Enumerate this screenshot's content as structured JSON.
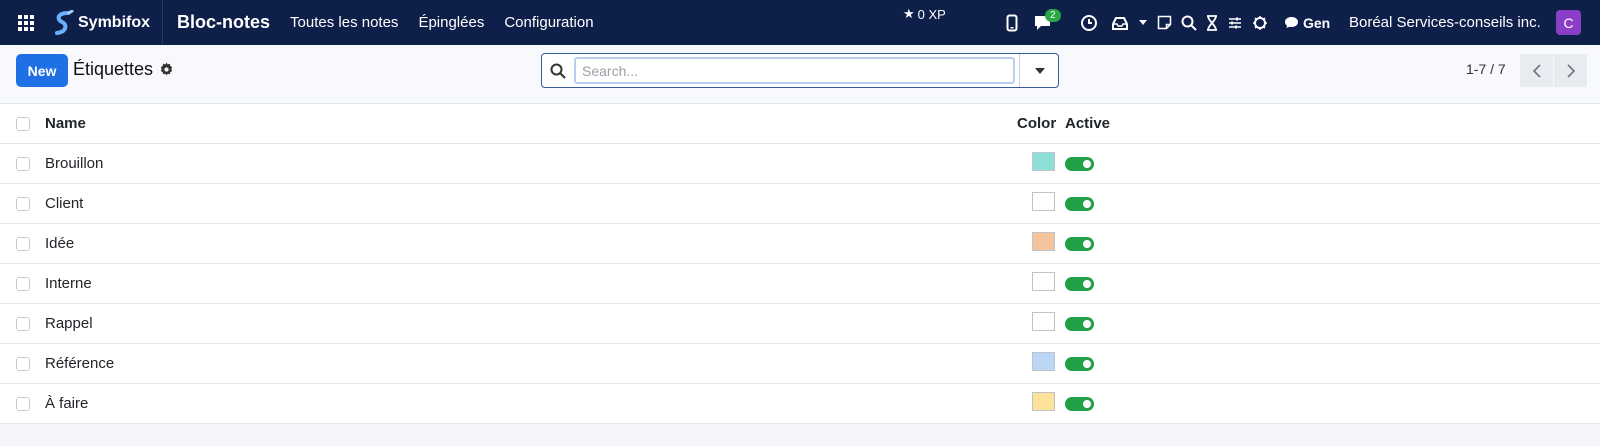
{
  "navbar": {
    "brand": "Symbifox",
    "app_title": "Bloc-notes",
    "menu": [
      "Toutes les notes",
      "Épinglées",
      "Configuration"
    ],
    "xp": "0 XP",
    "chat_badge": "2",
    "gen_label": "Gen",
    "company": "Boréal Services-conseils inc.",
    "avatar_letter": "C",
    "avatar_color": "#8a3ec8"
  },
  "control": {
    "new_label": "New",
    "title": "Étiquettes",
    "search_placeholder": "Search...",
    "pager": "1-7 / 7"
  },
  "table": {
    "headers": {
      "name": "Name",
      "color": "Color",
      "active": "Active"
    },
    "rows": [
      {
        "name": "Brouillon",
        "color": "#8ee0d6",
        "active": true
      },
      {
        "name": "Client",
        "color": "#ffffff",
        "active": true
      },
      {
        "name": "Idée",
        "color": "#f5c49c",
        "active": true
      },
      {
        "name": "Interne",
        "color": "#ffffff",
        "active": true
      },
      {
        "name": "Rappel",
        "color": "#ffffff",
        "active": true
      },
      {
        "name": "Référence",
        "color": "#bcd6f5",
        "active": true
      },
      {
        "name": "À faire",
        "color": "#fde39a",
        "active": true
      }
    ]
  }
}
